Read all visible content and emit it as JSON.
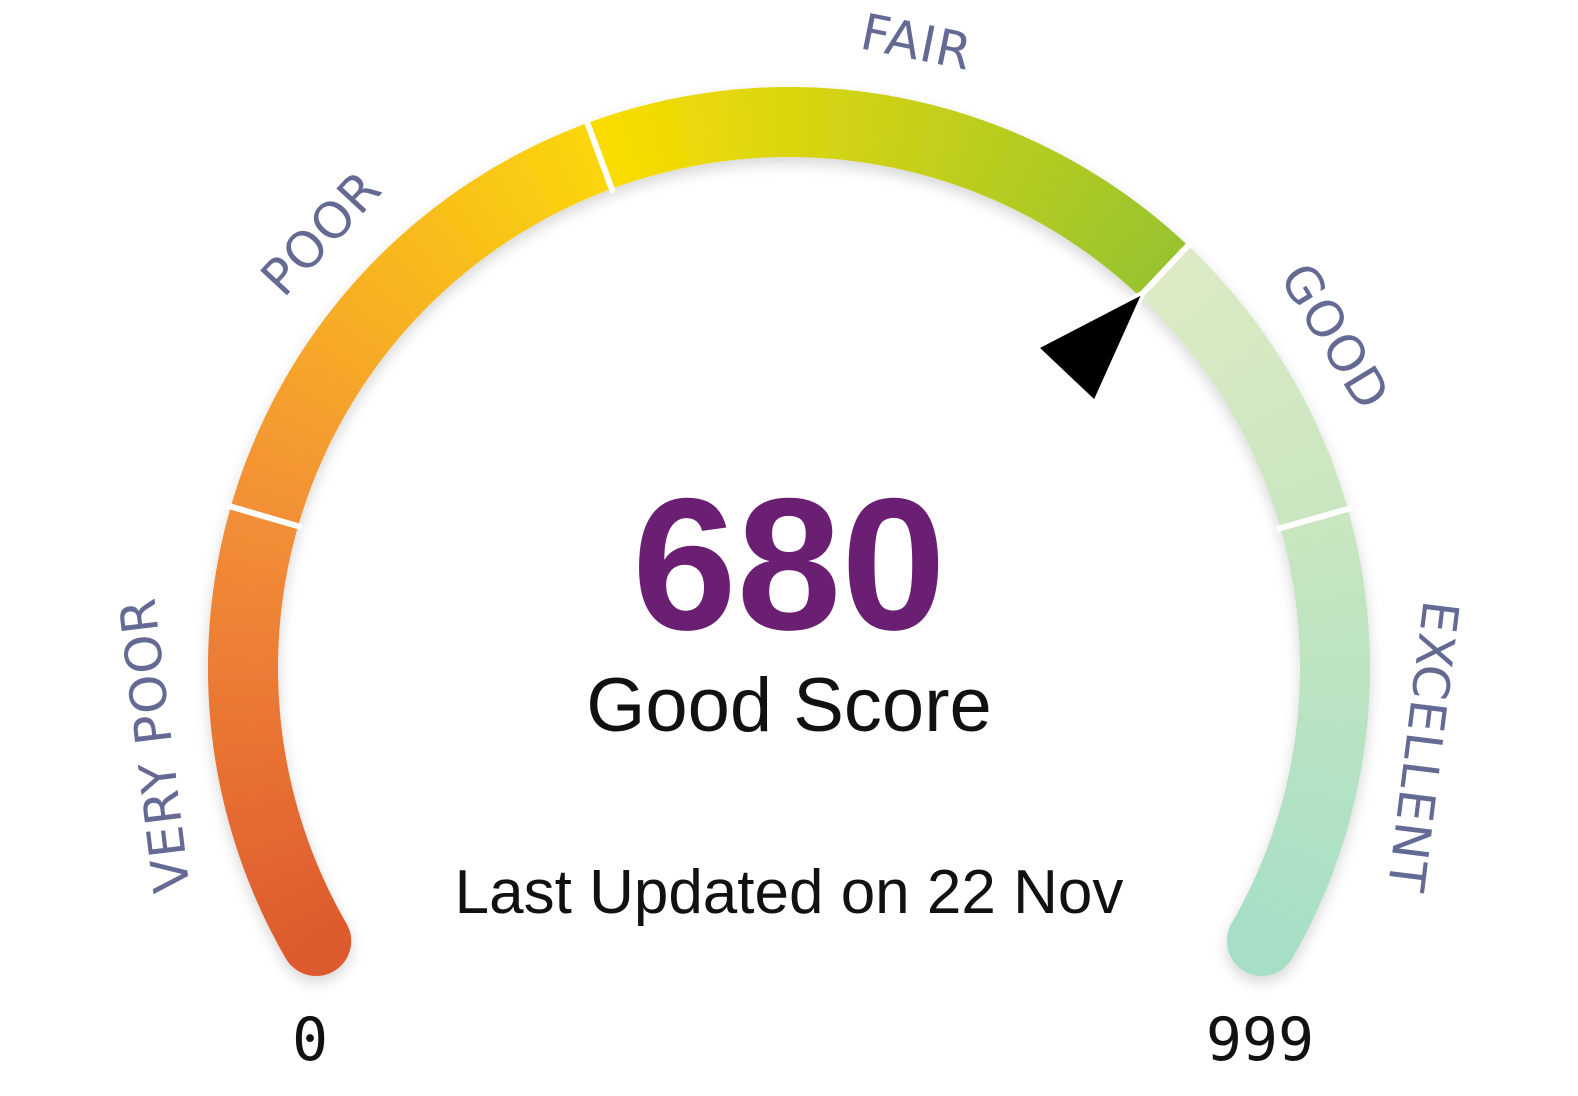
{
  "chart_data": {
    "type": "gauge",
    "value": 680,
    "min": 0,
    "max": 999,
    "value_label": "Good Score",
    "last_updated": "Last Updated on 22 Nov",
    "bands": [
      {
        "name": "VERY POOR",
        "from": 0,
        "to": 192,
        "color_start": "#dd5a2e",
        "color_end": "#f38f37"
      },
      {
        "name": "POOR",
        "from": 192,
        "to": 415,
        "color_start": "#f38f37",
        "color_end": "#fbd60c"
      },
      {
        "name": "FAIR",
        "from": 415,
        "to": 680,
        "color_start": "#fbdd00",
        "color_end": "#97c42f"
      },
      {
        "name": "GOOD",
        "from": 680,
        "to": 808,
        "color_start": "#dcebc5",
        "color_end": "#c9e6c0"
      },
      {
        "name": "EXCELLENT",
        "from": 808,
        "to": 999,
        "color_start": "#c9e6c0",
        "color_end": "#a6dfc6"
      }
    ]
  },
  "colors": {
    "score_value": "#6b1f72",
    "band_label": "#646a93",
    "pointer": "#000000",
    "text": "#111111"
  }
}
